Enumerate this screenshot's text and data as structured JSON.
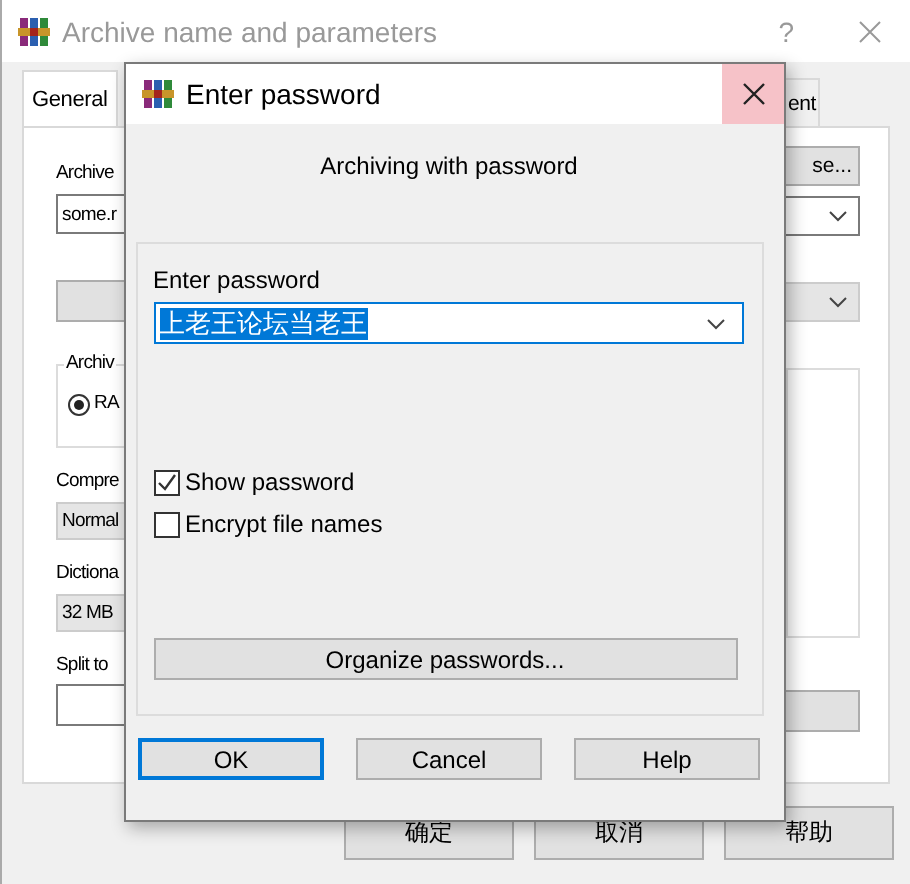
{
  "main_window": {
    "title": "Archive name and parameters",
    "help_glyph": "?",
    "tabs": [
      {
        "label": "General",
        "selected": true
      },
      {
        "label": "ent",
        "selected": false
      }
    ],
    "archive_label": "Archive",
    "browse_button": "se...",
    "archive_name": "some.r",
    "format_group": "Archiv",
    "format_option": {
      "label": "RA",
      "selected": true
    },
    "compression": {
      "label": "Compre",
      "value": "Normal"
    },
    "dictionary": {
      "label": "Dictiona",
      "value": "32 MB"
    },
    "split_label": "Split to",
    "buttons": [
      "确定",
      "取消",
      "帮助"
    ]
  },
  "dialog": {
    "title": "Enter password",
    "heading": "Archiving with password",
    "password": {
      "label": "Enter password",
      "value": "上老王论坛当老王"
    },
    "options": [
      {
        "label": "Show password",
        "checked": true
      },
      {
        "label": "Encrypt file names",
        "checked": false
      }
    ],
    "organize_button": "Organize passwords...",
    "buttons": [
      {
        "label": "OK",
        "default": true
      },
      {
        "label": "Cancel",
        "default": false
      },
      {
        "label": "Help",
        "default": false
      }
    ]
  }
}
